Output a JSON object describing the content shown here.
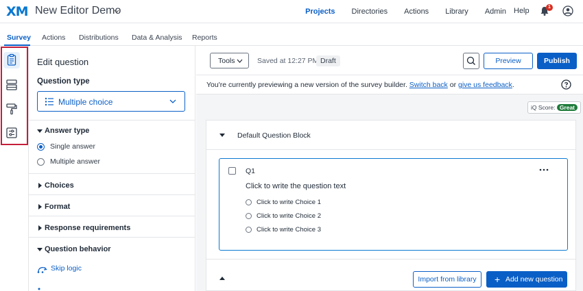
{
  "header": {
    "logo": "XM",
    "project_title": "New Editor Demo",
    "nav": [
      "Projects",
      "Directories",
      "Actions",
      "Library",
      "Admin"
    ],
    "active_nav": "Projects",
    "help": "Help",
    "notification_count": "1"
  },
  "tabs": [
    "Survey",
    "Actions",
    "Distributions",
    "Data & Analysis",
    "Reports"
  ],
  "rail_icons": [
    "clipboard-icon",
    "layout-icon",
    "paint-roller-icon",
    "sliders-icon"
  ],
  "edit_panel": {
    "title": "Edit question",
    "question_type_label": "Question type",
    "question_type_value": "Multiple choice",
    "answer_type_title": "Answer type",
    "answer_options": [
      "Single answer",
      "Multiple answer"
    ],
    "sections": [
      "Choices",
      "Format",
      "Response requirements"
    ],
    "question_behavior_title": "Question behavior",
    "skip_logic": "Skip logic"
  },
  "toolbar": {
    "tools_label": "Tools",
    "saved_text": "Saved at 12:27 PM",
    "draft": "Draft",
    "preview": "Preview",
    "publish": "Publish"
  },
  "notice": {
    "text_before": "You're currently previewing a new version of the survey builder.",
    "switch_back": "Switch back",
    "or": "or",
    "feedback": "give us feedback",
    "period": "."
  },
  "iq_score": {
    "label": "iQ Score:",
    "value": "Great"
  },
  "block": {
    "title": "Default Question Block",
    "question": {
      "number": "Q1",
      "text": "Click to write the question text",
      "choices": [
        "Click to write Choice 1",
        "Click to write Choice 2",
        "Click to write Choice 3"
      ]
    },
    "import_button": "Import from library",
    "add_button": "Add new question"
  },
  "colors": {
    "accent": "#0a5fc7",
    "highlight_border": "#c41e3a",
    "badge_green": "#1e7b3a",
    "notification_red": "#d92d20"
  }
}
